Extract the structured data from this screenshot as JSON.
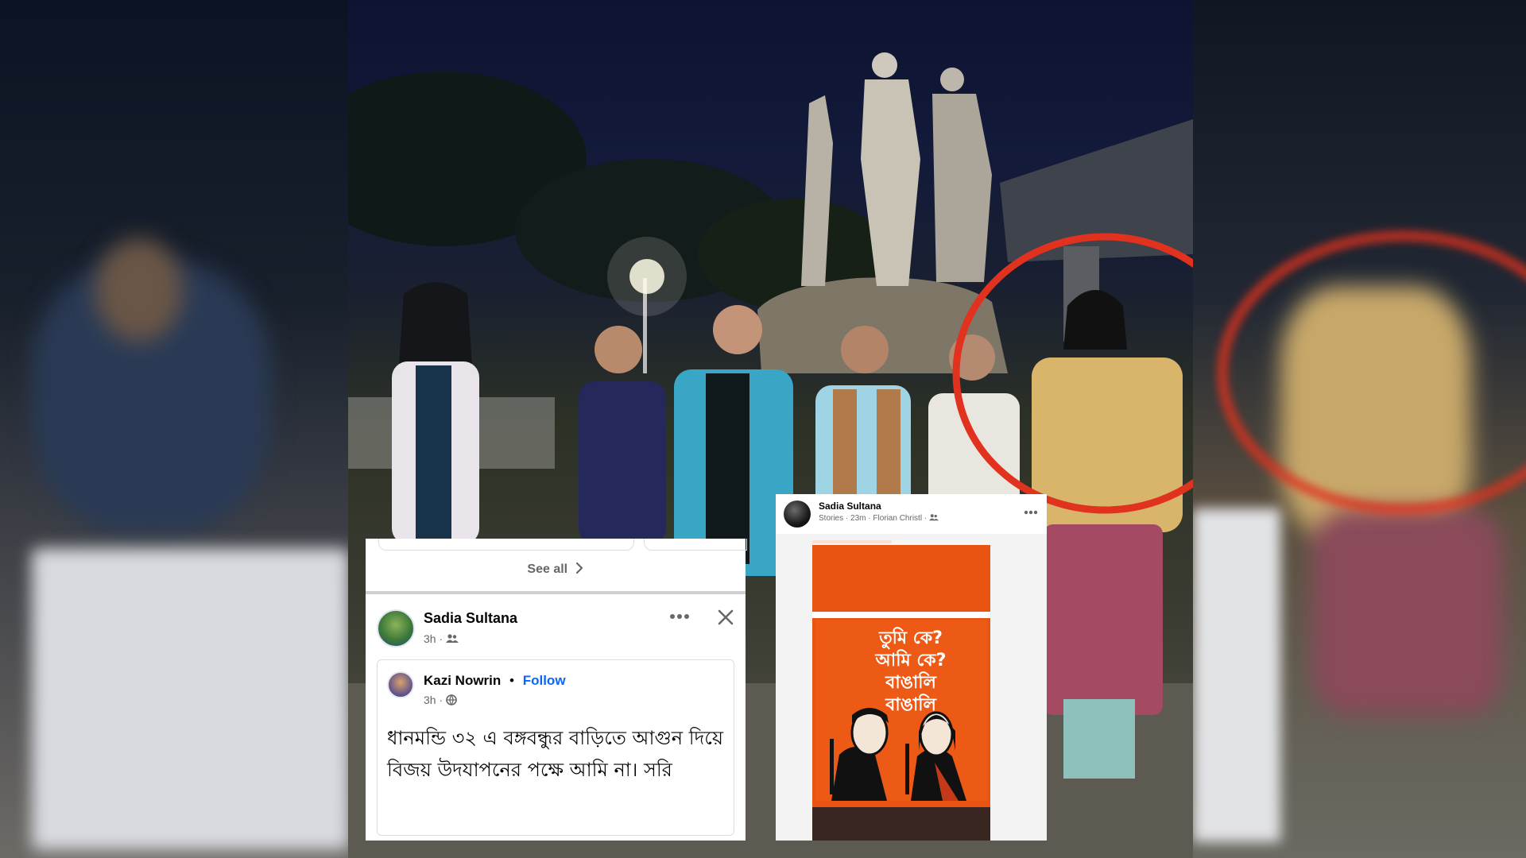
{
  "left_post": {
    "see_all": "See all",
    "author": "Sadia Sultana",
    "meta": "3h ·",
    "shared": {
      "author": "Kazi Nowrin",
      "separator": "•",
      "follow": "Follow",
      "meta": "3h ·",
      "text": "ধানমন্ডি ৩২ এ বঙ্গবন্ধুর বাড়িতে আগুন দিয়ে বিজয় উদযাপনের পক্ষে আমি না। সরি"
    }
  },
  "story": {
    "author": "Sadia Sultana",
    "meta_stories": "Stories",
    "meta_time": "23m",
    "meta_music": "Florian Christl",
    "poster_lines": [
      "তুমি কে?",
      "আমি কে?",
      "বাঙালি",
      "বাঙালি"
    ]
  },
  "colors": {
    "facebook_blue": "#0866ff",
    "highlight_ring": "#e0321e",
    "poster_orange": "#ea5413"
  },
  "icons": [
    "friends-audience-icon",
    "globe-audience-icon",
    "more-options-icon",
    "close-icon",
    "chevron-right-icon"
  ]
}
